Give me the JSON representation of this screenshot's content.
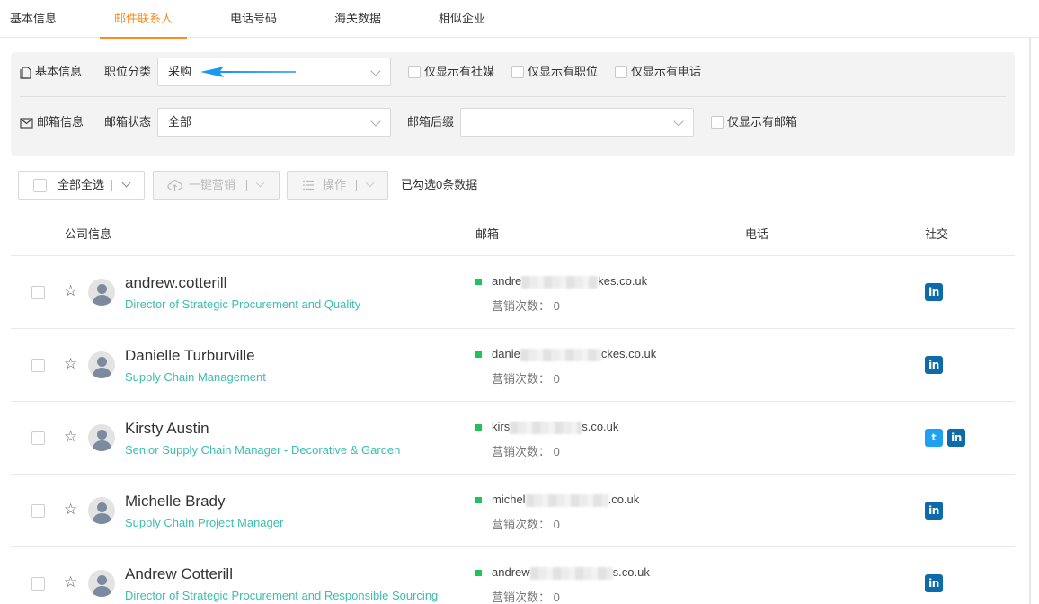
{
  "tabs": [
    {
      "label": "基本信息",
      "active": false
    },
    {
      "label": "邮件联系人",
      "active": true
    },
    {
      "label": "电话号码",
      "active": false
    },
    {
      "label": "海关数据",
      "active": false
    },
    {
      "label": "相似企业",
      "active": false
    }
  ],
  "filters": {
    "basic_label": "基本信息",
    "job_label": "职位分类",
    "job_value": "采购",
    "only_social": "仅显示有社媒",
    "only_title": "仅显示有职位",
    "only_phone": "仅显示有电话",
    "mail_label": "邮箱信息",
    "mail_status_label": "邮箱状态",
    "mail_status_value": "全部",
    "mail_suffix_label": "邮箱后缀",
    "mail_suffix_value": "",
    "only_email": "仅显示有邮箱"
  },
  "toolbar": {
    "select_all": "全部全选",
    "one_click": "一键营销",
    "actions": "操作",
    "selected_count": "已勾选0条数据"
  },
  "columns": {
    "company": "公司信息",
    "email": "邮箱",
    "phone": "电话",
    "social": "社交"
  },
  "contacts": [
    {
      "name": "andrew.cotterill",
      "title": "Director of Strategic Procurement and Quality",
      "email_start": "andre",
      "email_end": "kes.co.uk",
      "marketing": "营销次数：  0",
      "social": [
        "linkedin"
      ]
    },
    {
      "name": "Danielle Turburville",
      "title": "Supply Chain Management",
      "email_start": "danie",
      "email_end": "ckes.co.uk",
      "marketing": "营销次数：  0",
      "social": [
        "linkedin"
      ]
    },
    {
      "name": "Kirsty Austin",
      "title": "Senior Supply Chain Manager - Decorative & Garden",
      "email_start": "kirs",
      "email_end": "s.co.uk",
      "marketing": "营销次数：  0",
      "social": [
        "twitter",
        "linkedin"
      ]
    },
    {
      "name": "Michelle Brady",
      "title": "Supply Chain Project Manager",
      "email_start": "michel",
      "email_end": ".co.uk",
      "marketing": "营销次数：  0",
      "social": [
        "linkedin"
      ]
    },
    {
      "name": "Andrew Cotterill",
      "title": "Director of Strategic Procurement and Responsible Sourcing",
      "email_start": "andrew",
      "email_end": "s.co.uk",
      "marketing": "营销次数：  0",
      "social": [
        "linkedin"
      ]
    }
  ],
  "icons": {
    "linkedin": "in",
    "twitter": "t"
  },
  "colors": {
    "accent": "#ff8a1f",
    "title_teal": "#3dbdb0",
    "arrow_blue": "#1b9af2",
    "email_ok": "#1fc25f",
    "linkedin": "#0e6aa8",
    "twitter": "#1da1f2"
  }
}
